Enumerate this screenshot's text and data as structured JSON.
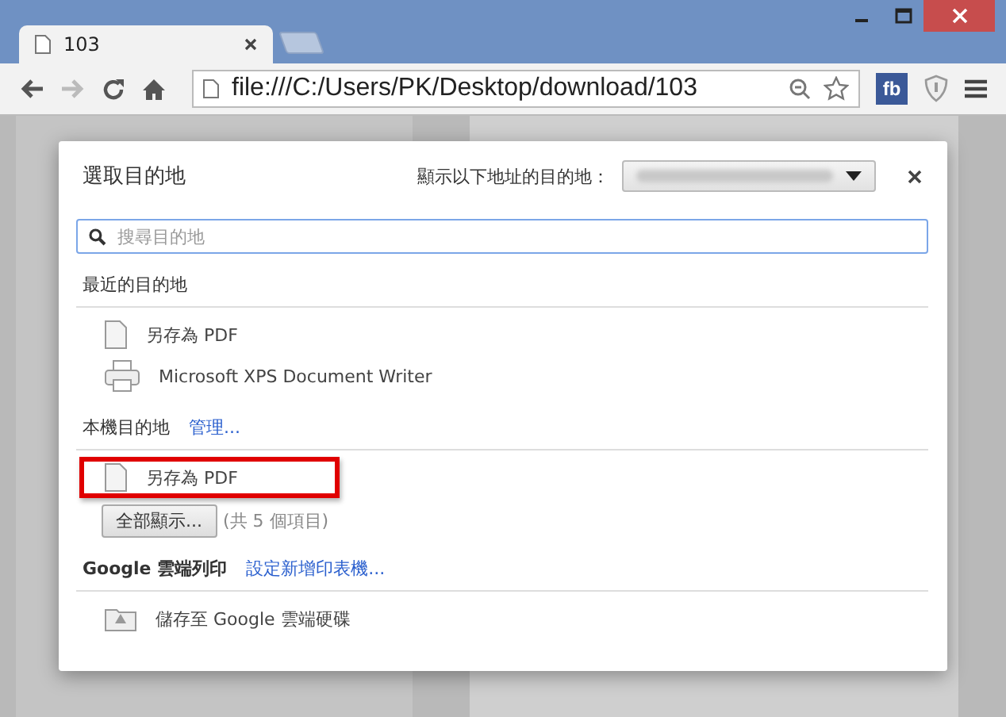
{
  "tab": {
    "title": "103"
  },
  "address": {
    "url": "file:///C:/Users/PK/Desktop/download/103"
  },
  "extension_badge": "fb",
  "dialog": {
    "title": "選取目的地",
    "account_label": "顯示以下地址的目的地：",
    "search": {
      "placeholder": "搜尋目的地"
    },
    "sections": [
      {
        "heading": "最近的目的地",
        "bold": false,
        "items": [
          {
            "kind": "file",
            "label": "另存為 PDF",
            "highlighted": false
          },
          {
            "kind": "printer",
            "label": "Microsoft XPS Document Writer",
            "highlighted": false
          }
        ]
      },
      {
        "heading": "本機目的地",
        "bold": false,
        "link": "管理...",
        "items": [
          {
            "kind": "file",
            "label": "另存為 PDF",
            "highlighted": true
          }
        ],
        "show_all": {
          "button": "全部顯示...",
          "count": "(共 5 個項目)"
        }
      },
      {
        "heading": "Google 雲端列印",
        "bold": true,
        "link": "設定新增印表機...",
        "items": [
          {
            "kind": "drive",
            "label": "儲存至 Google 雲端硬碟",
            "highlighted": false
          }
        ]
      }
    ]
  }
}
